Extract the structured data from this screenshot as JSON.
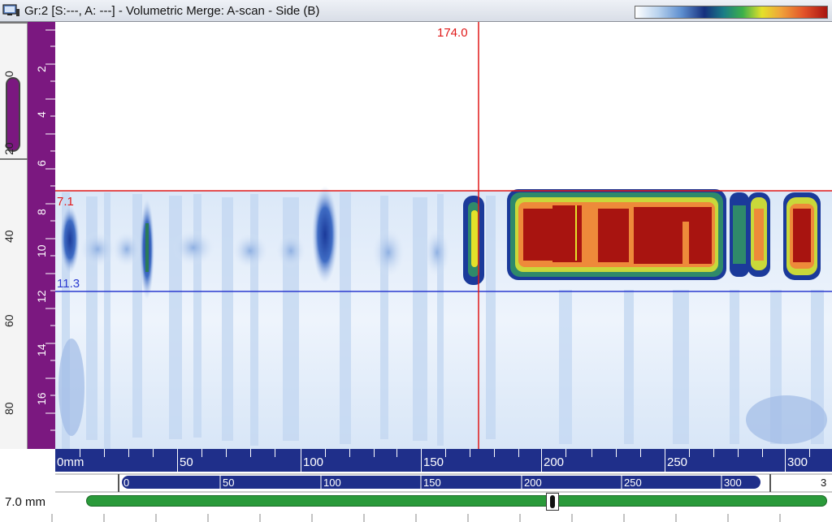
{
  "window": {
    "title": "Gr:2 [S:---, A: ---] -  Volumetric Merge: A-scan - Side (B)",
    "icon": "monitor-icon"
  },
  "palette": {
    "colors": [
      "#ffffff",
      "#b8d2ee",
      "#5e8fd0",
      "#16307e",
      "#1a7c86",
      "#3cb04a",
      "#e4e12a",
      "#f0a23a",
      "#e2522a",
      "#a81410"
    ]
  },
  "depth_ruler": {
    "labels": [
      "2",
      "4",
      "6",
      "8",
      "10",
      "12",
      "14",
      "16"
    ],
    "color": "#7b1880"
  },
  "left_panel": {
    "labels": [
      "0",
      "20",
      "40",
      "60",
      "80"
    ]
  },
  "cursors": {
    "vertical_value": "174.0",
    "horizontal_top_value": "7.1",
    "horizontal_bottom_value": "11.3",
    "vertical_color": "#e01818",
    "top_color": "#e01818",
    "bottom_color": "#2a3ad0"
  },
  "scan_axis": {
    "labels": [
      "0mm",
      "50",
      "100",
      "150",
      "200",
      "250",
      "300"
    ],
    "color": "#1f2f8a"
  },
  "scroll_axis": {
    "labels": [
      "0",
      "50",
      "100",
      "150",
      "200",
      "250",
      "300"
    ],
    "overflow_label": "3"
  },
  "resolution": {
    "label": "7.0 mm"
  }
}
